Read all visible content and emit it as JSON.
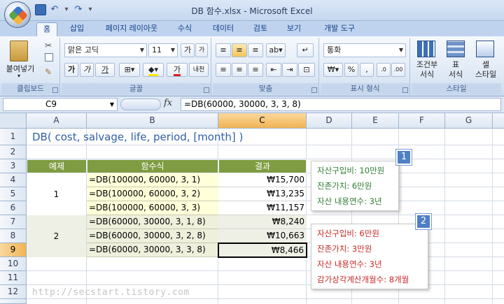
{
  "window": {
    "title": "DB 함수.xlsx - Microsoft Excel"
  },
  "tabs": [
    "홈",
    "삽입",
    "페이지 레이아웃",
    "수식",
    "데이터",
    "검토",
    "보기",
    "개발 도구"
  ],
  "ribbon": {
    "clipboard": {
      "paste_label": "붙여넣기",
      "group": "클립보드"
    },
    "font": {
      "name": "맑은 고딕",
      "size": "11",
      "grow": "가",
      "shrink": "가",
      "bold": "가",
      "italic": "가",
      "underline": "가",
      "color_glyph": "가",
      "phonetic": "내천",
      "group": "글꼴"
    },
    "alignment": {
      "group": "맞춤"
    },
    "number": {
      "format": "통화",
      "currency": "₩",
      "percent": "%",
      "comma": ",",
      "group": "표시 형식"
    },
    "styles": {
      "cond_line1": "조건부",
      "cond_line2": "서식",
      "table_line1": "표",
      "table_line2": "서식",
      "cell_line1": "셀",
      "cell_line2": "스타일",
      "group": "스타일"
    }
  },
  "formula_bar": {
    "name_box": "C9",
    "fx": "fx",
    "formula": "=DB(60000, 30000, 3, 3, 8)"
  },
  "sheet": {
    "columns": [
      "A",
      "B",
      "C",
      "D",
      "E",
      "F",
      "G"
    ],
    "rows": [
      "1",
      "2",
      "3",
      "4",
      "5",
      "6",
      "7",
      "8",
      "9",
      "10",
      "11",
      "12"
    ],
    "title": "DB( cost, salvage, life, period, [month] )",
    "headers": {
      "a": "예제",
      "b": "함수식",
      "c": "결과"
    },
    "group1_label": "1",
    "group2_label": "2",
    "data": [
      {
        "formula": "=DB(100000, 60000, 3, 1)",
        "result": "₩15,700"
      },
      {
        "formula": "=DB(100000, 60000, 3, 2)",
        "result": "₩13,235"
      },
      {
        "formula": "=DB(100000, 60000, 3, 3)",
        "result": "₩11,157"
      },
      {
        "formula": "=DB(60000, 30000, 3, 1, 8)",
        "result": "₩8,240"
      },
      {
        "formula": "=DB(60000, 30000, 3, 2, 8)",
        "result": "₩10,663"
      },
      {
        "formula": "=DB(60000, 30000, 3, 3, 8)",
        "result": "₩8,466"
      }
    ]
  },
  "callouts": [
    {
      "badge": "1",
      "color": "#2e7d32",
      "lines": [
        "자산구입비: 10만원",
        "잔존가치: 6만원",
        "자산 내용연수: 3년"
      ]
    },
    {
      "badge": "2",
      "color": "#c62828",
      "lines": [
        "자산구입비: 6만원",
        "잔존가치: 3만원",
        "자산 내용연수: 3년",
        "감가상각계산개월수: 8개월"
      ]
    }
  ],
  "watermark": "http://secstart.tistory.com",
  "colors": {
    "header_green": "#7f9c42",
    "formula_yellow": "#ffffd9",
    "title_blue": "#2f5fa8",
    "badge_blue": "#4f7fc4",
    "selection_orange": "#f1b354"
  }
}
